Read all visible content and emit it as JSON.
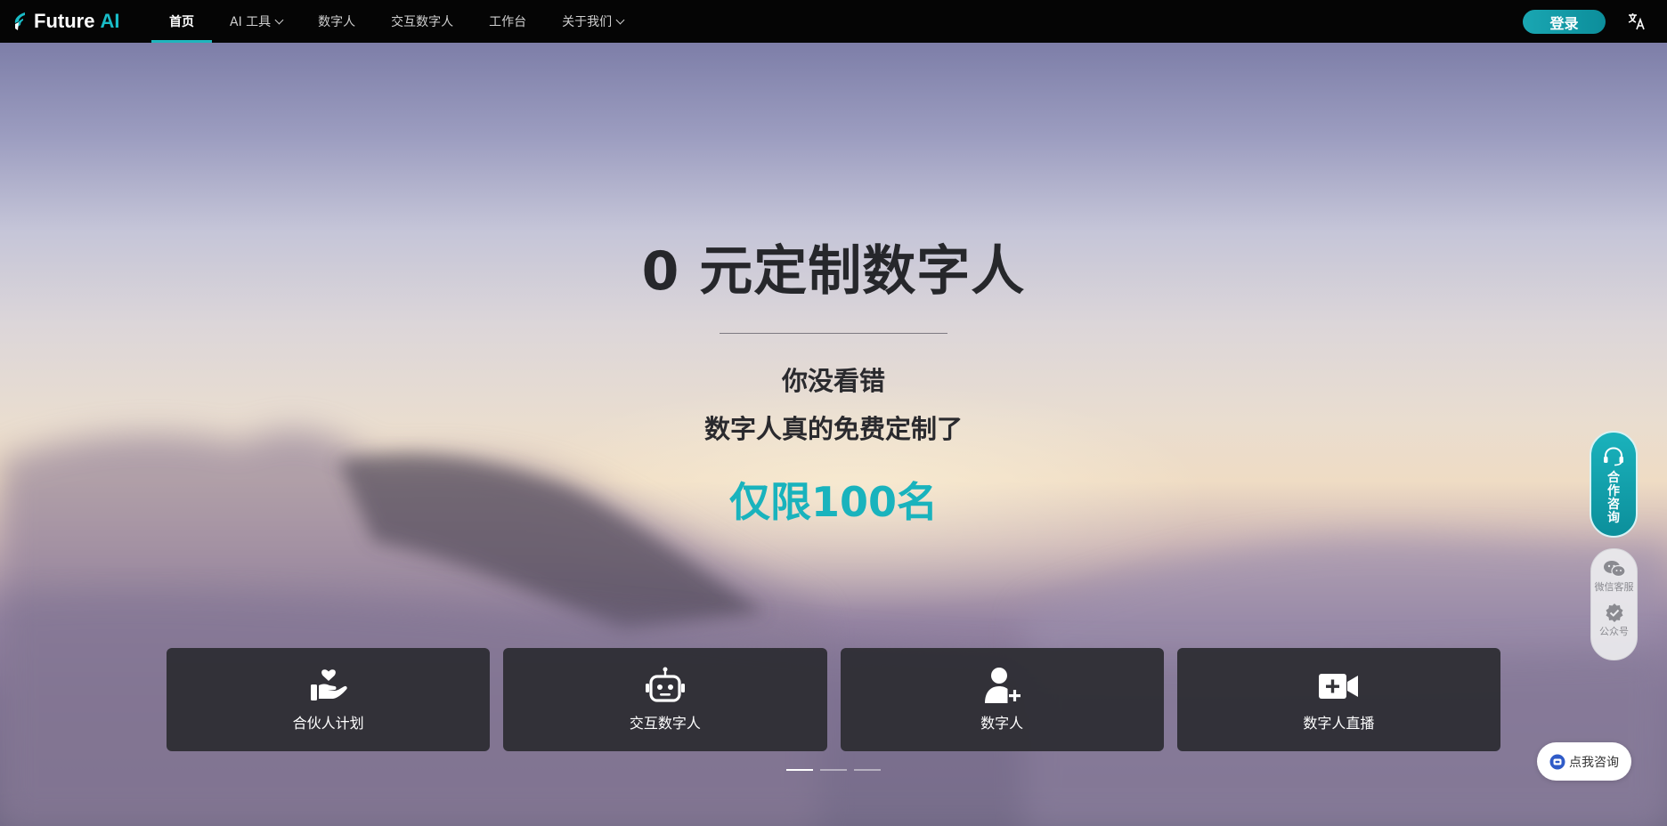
{
  "brand": {
    "name": "Future",
    "suffix": "AI",
    "accent": "#19bcc7"
  },
  "nav": {
    "items": [
      {
        "label": "首页",
        "active": true,
        "dropdown": false
      },
      {
        "label": "AI 工具",
        "active": false,
        "dropdown": true
      },
      {
        "label": "数字人",
        "active": false,
        "dropdown": false
      },
      {
        "label": "交互数字人",
        "active": false,
        "dropdown": false
      },
      {
        "label": "工作台",
        "active": false,
        "dropdown": false
      },
      {
        "label": "关于我们",
        "active": false,
        "dropdown": true
      }
    ],
    "login_label": "登录",
    "language_icon": "translate-icon"
  },
  "hero": {
    "headline": "0 元定制数字人",
    "line1": "你没看错",
    "line2": "数字人真的免费定制了",
    "highlight": "仅限100名",
    "highlight_color": "#19b3bd"
  },
  "cards": [
    {
      "label": "合伙人计划",
      "icon": "heart-hand-icon"
    },
    {
      "label": "交互数字人",
      "icon": "robot-icon"
    },
    {
      "label": "数字人",
      "icon": "add-user-icon"
    },
    {
      "label": "数字人直播",
      "icon": "video-camera-icon"
    }
  ],
  "carousel": {
    "slides": 3,
    "active_index": 0
  },
  "float": {
    "consult_label": "合作咨询",
    "wechat_label": "微信客服",
    "official_label": "公众号",
    "chat_label": "点我咨询"
  }
}
